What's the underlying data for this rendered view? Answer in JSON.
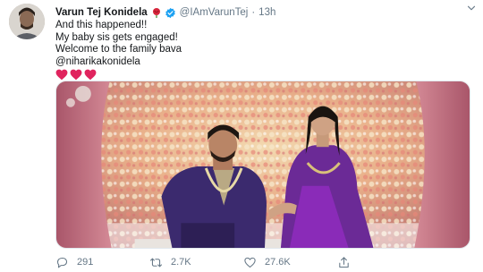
{
  "tweet": {
    "author_name": "Varun Tej Konidela",
    "handle": "@IAmVarunTej",
    "separator": "·",
    "time": "13h",
    "lines": [
      "And this happened!!",
      "My baby sis gets engaged!",
      "Welcome to the family bava",
      "@niharikakonidela"
    ],
    "icons": {
      "rose": "rose-emoji-icon",
      "verified": "verified-badge-icon",
      "more": "chevron-down-icon",
      "hearts": [
        "red-heart-icon",
        "red-heart-icon",
        "red-heart-icon"
      ]
    },
    "colors": {
      "verified": "#1da1f2",
      "heart": "#e0245e",
      "muted": "#657786"
    }
  },
  "actions": {
    "reply_count": "291",
    "retweet_count": "2.7K",
    "like_count": "27.6K"
  }
}
